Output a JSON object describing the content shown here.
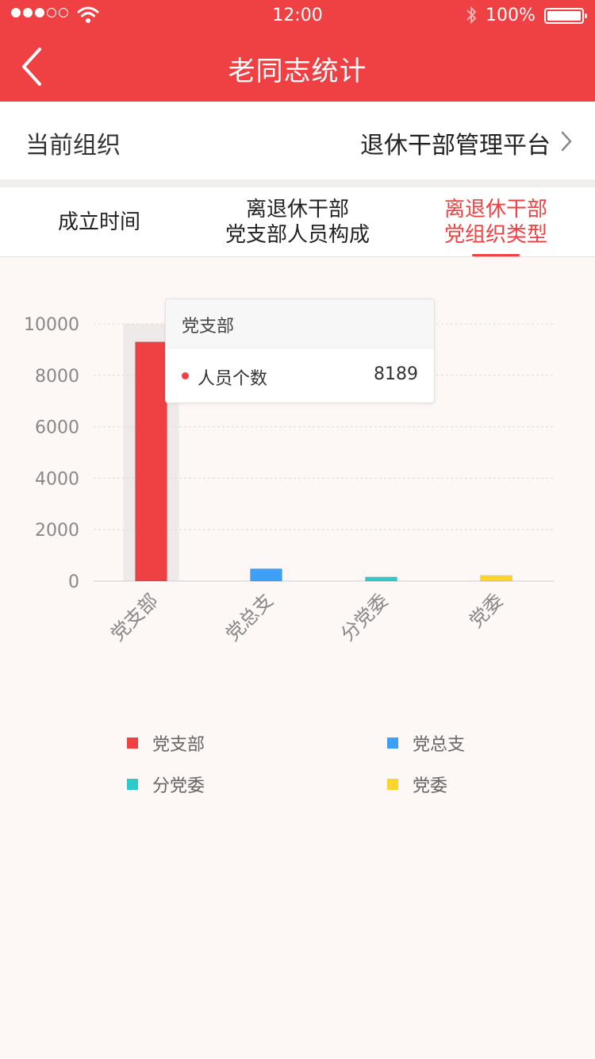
{
  "status_bar": {
    "time": "12:00",
    "battery": "100%"
  },
  "nav": {
    "title": "老同志统计"
  },
  "org": {
    "label": "当前组织",
    "value": "退休干部管理平台"
  },
  "tabs": [
    {
      "line1": "成立时间",
      "line2": ""
    },
    {
      "line1": "离退休干部",
      "line2": "党支部人员构成"
    },
    {
      "line1": "离退休干部",
      "line2": "党组织类型"
    }
  ],
  "active_tab": 2,
  "tooltip": {
    "title": "党支部",
    "label": "人员个数",
    "value": "8189"
  },
  "colors": {
    "brand": "#ef4044",
    "blue": "#3d9ff5",
    "cyan": "#2ec9c9",
    "yellow": "#fdd32e"
  },
  "chart_data": {
    "type": "bar",
    "categories": [
      "党支部",
      "党总支",
      "分党委",
      "党委"
    ],
    "values": [
      9300,
      480,
      160,
      220
    ],
    "colors": [
      "#ef4044",
      "#3d9ff5",
      "#2ec9c9",
      "#fdd32e"
    ],
    "ylim": [
      0,
      10000
    ],
    "yticks": [
      "0",
      "2000",
      "4000",
      "6000",
      "8000",
      "10000"
    ],
    "ytick_values": [
      0,
      2000,
      4000,
      6000,
      8000,
      10000
    ],
    "highlight_index": 0,
    "grid": true,
    "legend": "bottom",
    "title": "",
    "xlabel": "",
    "ylabel": ""
  },
  "legend": [
    {
      "label": "党支部",
      "color": "#ef4044"
    },
    {
      "label": "党总支",
      "color": "#3d9ff5"
    },
    {
      "label": "分党委",
      "color": "#2ec9c9"
    },
    {
      "label": "党委",
      "color": "#fdd32e"
    }
  ]
}
